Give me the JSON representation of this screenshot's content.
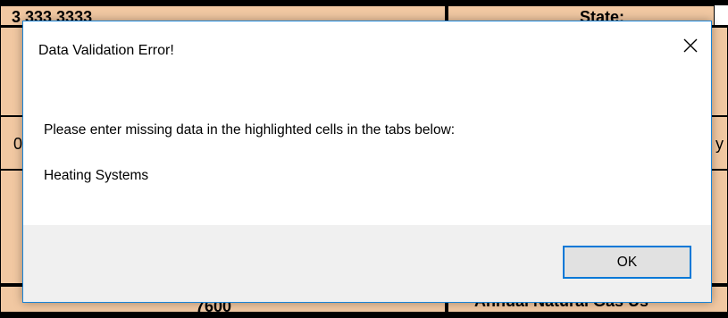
{
  "background_sheet": {
    "top_left_text": "3 333 3333",
    "top_right_text": "State:",
    "bottom_center_text": "7600",
    "bottom_right_text": "Annual Natural Gas Us",
    "left_edge_text": "0",
    "right_edge_text": "y"
  },
  "dialog": {
    "title": "Data Validation Error!",
    "close_icon": "close-icon",
    "message_line_1": "Please enter missing data in the highlighted cells in the tabs below:",
    "message_line_2": "Heating Systems",
    "ok_label": "OK"
  },
  "colors": {
    "cell_fill": "#f1c8a2",
    "dialog_border": "#1883d7",
    "footer_bg": "#f0f0f0",
    "ok_border": "#0078d7",
    "ok_bg": "#e1e1e1"
  }
}
